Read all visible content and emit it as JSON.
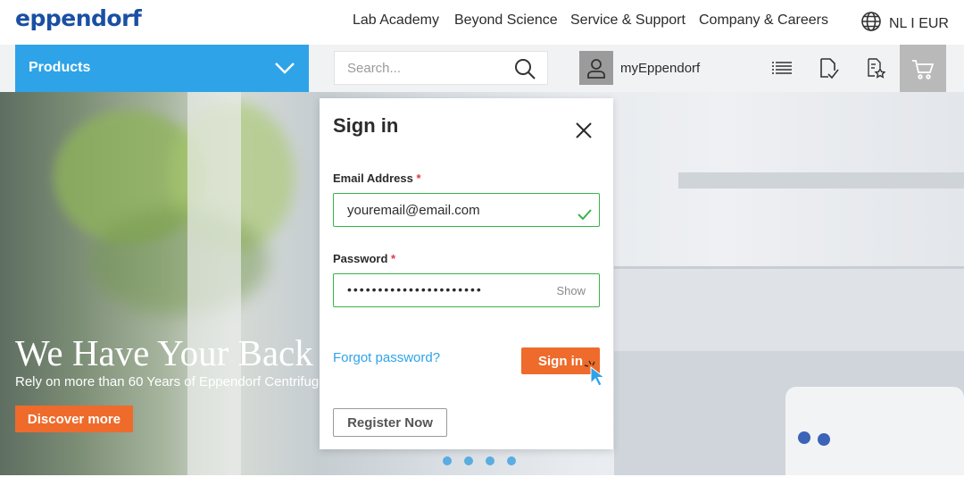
{
  "header": {
    "logo": "eppendorf",
    "nav": [
      "Lab Academy",
      "Beyond Science",
      "Service & Support",
      "Company & Careers"
    ],
    "language": "NL I EUR"
  },
  "toolbar": {
    "products_label": "Products",
    "search_placeholder": "Search...",
    "account_label": "myEppendorf",
    "icons": [
      "list-icon",
      "document-check-icon",
      "favorites-icon",
      "cart-icon"
    ]
  },
  "hero": {
    "title": "We Have Your Back",
    "subtitle": "Rely on more than 60 Years of Eppendorf Centrifug",
    "button": "Discover more",
    "slide_count": 4
  },
  "signin": {
    "title": "Sign in",
    "email_label": "Email Address",
    "email_value": "youremail@email.com",
    "password_label": "Password",
    "password_mask": "••••••••••••••••••••••",
    "show_label": "Show",
    "required_mark": "*",
    "forgot_label": "Forgot password?",
    "submit_label": "Sign in",
    "register_label": "Register Now"
  },
  "colors": {
    "brand_blue": "#1a4fa3",
    "accent_blue": "#2ea3e8",
    "accent_orange": "#ee6b2b",
    "valid_green": "#38b449"
  }
}
